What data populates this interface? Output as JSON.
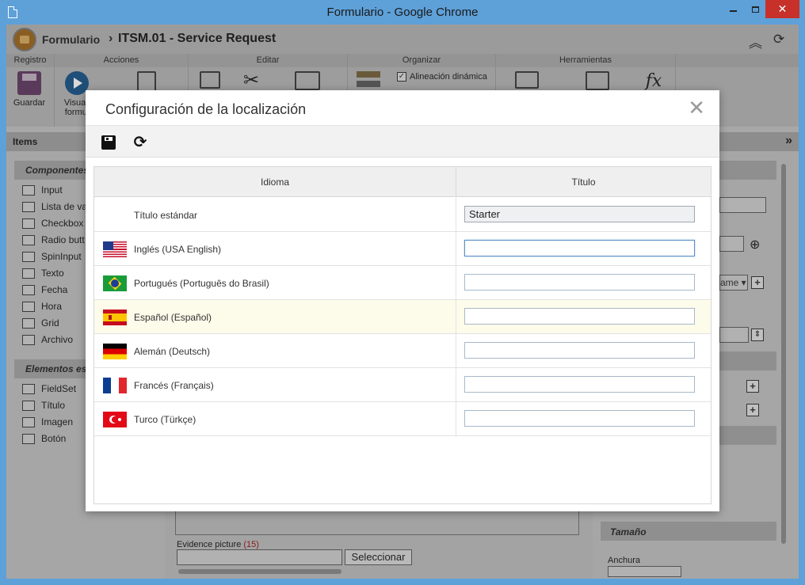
{
  "window": {
    "title": "Formulario - Google Chrome"
  },
  "app": {
    "breadcrumb": {
      "parent": "Formulario",
      "separator": "›",
      "current": "ITSM.01 - Service Request"
    }
  },
  "ribbon": {
    "groups": {
      "registro": "Registro",
      "acciones": "Acciones",
      "editar": "Editar",
      "organizar": "Organizar",
      "herramientas": "Herramientas"
    },
    "buttons": {
      "guardar": "Guardar",
      "visualizar_1": "Visuali",
      "visualizar_2": "formul"
    },
    "alineacion_label": "Alineación dinámica",
    "alineacion_checked": true,
    "fx_label": "fx"
  },
  "items_panel": {
    "title": "Items",
    "componentes_header": "Componentes",
    "componentes": [
      {
        "icon": "abc",
        "label": "Input"
      },
      {
        "icon": "list",
        "label": "Lista de va"
      },
      {
        "icon": "check",
        "label": "Checkbox"
      },
      {
        "icon": "radio",
        "label": "Radio butt"
      },
      {
        "icon": "123",
        "label": "SpinInput"
      },
      {
        "icon": "text",
        "label": "Texto"
      },
      {
        "icon": "date",
        "label": "Fecha"
      },
      {
        "icon": "clock",
        "label": "Hora"
      },
      {
        "icon": "grid",
        "label": "Grid"
      },
      {
        "icon": "abc",
        "label": "Archivo"
      }
    ],
    "elementos_header": "Elementos es",
    "elementos": [
      {
        "icon": "xy",
        "label": "FieldSet"
      },
      {
        "icon": "abc",
        "label": "Título"
      },
      {
        "icon": "image",
        "label": "Imagen"
      },
      {
        "icon": "button",
        "label": "Botón"
      }
    ]
  },
  "right_panel": {
    "tamano_header": "Tamaño",
    "anchura_label": "Anchura",
    "select_value": "ame"
  },
  "center": {
    "evidence_label": "Evidence picture",
    "evidence_count": "(15)",
    "select_button": "Seleccionar"
  },
  "modal": {
    "title": "Configuración de la localización",
    "close_glyph": "✕",
    "toolbar": {
      "refresh_glyph": "⟳"
    },
    "grid": {
      "headers": {
        "idioma": "Idioma",
        "titulo": "Título"
      },
      "rows": [
        {
          "flag": "none",
          "language": "Título estándar",
          "value": "Starter",
          "readonly": true
        },
        {
          "flag": "us",
          "language": "Inglés (USA English)",
          "value": "",
          "focused": true
        },
        {
          "flag": "br",
          "language": "Portugués (Português do Brasil)",
          "value": ""
        },
        {
          "flag": "es",
          "language": "Español (Español)",
          "value": "",
          "highlighted": true
        },
        {
          "flag": "de",
          "language": "Alemán (Deutsch)",
          "value": ""
        },
        {
          "flag": "fr",
          "language": "Francés (Français)",
          "value": ""
        },
        {
          "flag": "tr",
          "language": "Turco (Türkçe)",
          "value": ""
        }
      ]
    }
  },
  "colors": {
    "window_frame": "#5ea0d8",
    "close_button": "#c7312a",
    "highlight_row": "#fdfbea",
    "focus_border": "#5b8ec4"
  }
}
